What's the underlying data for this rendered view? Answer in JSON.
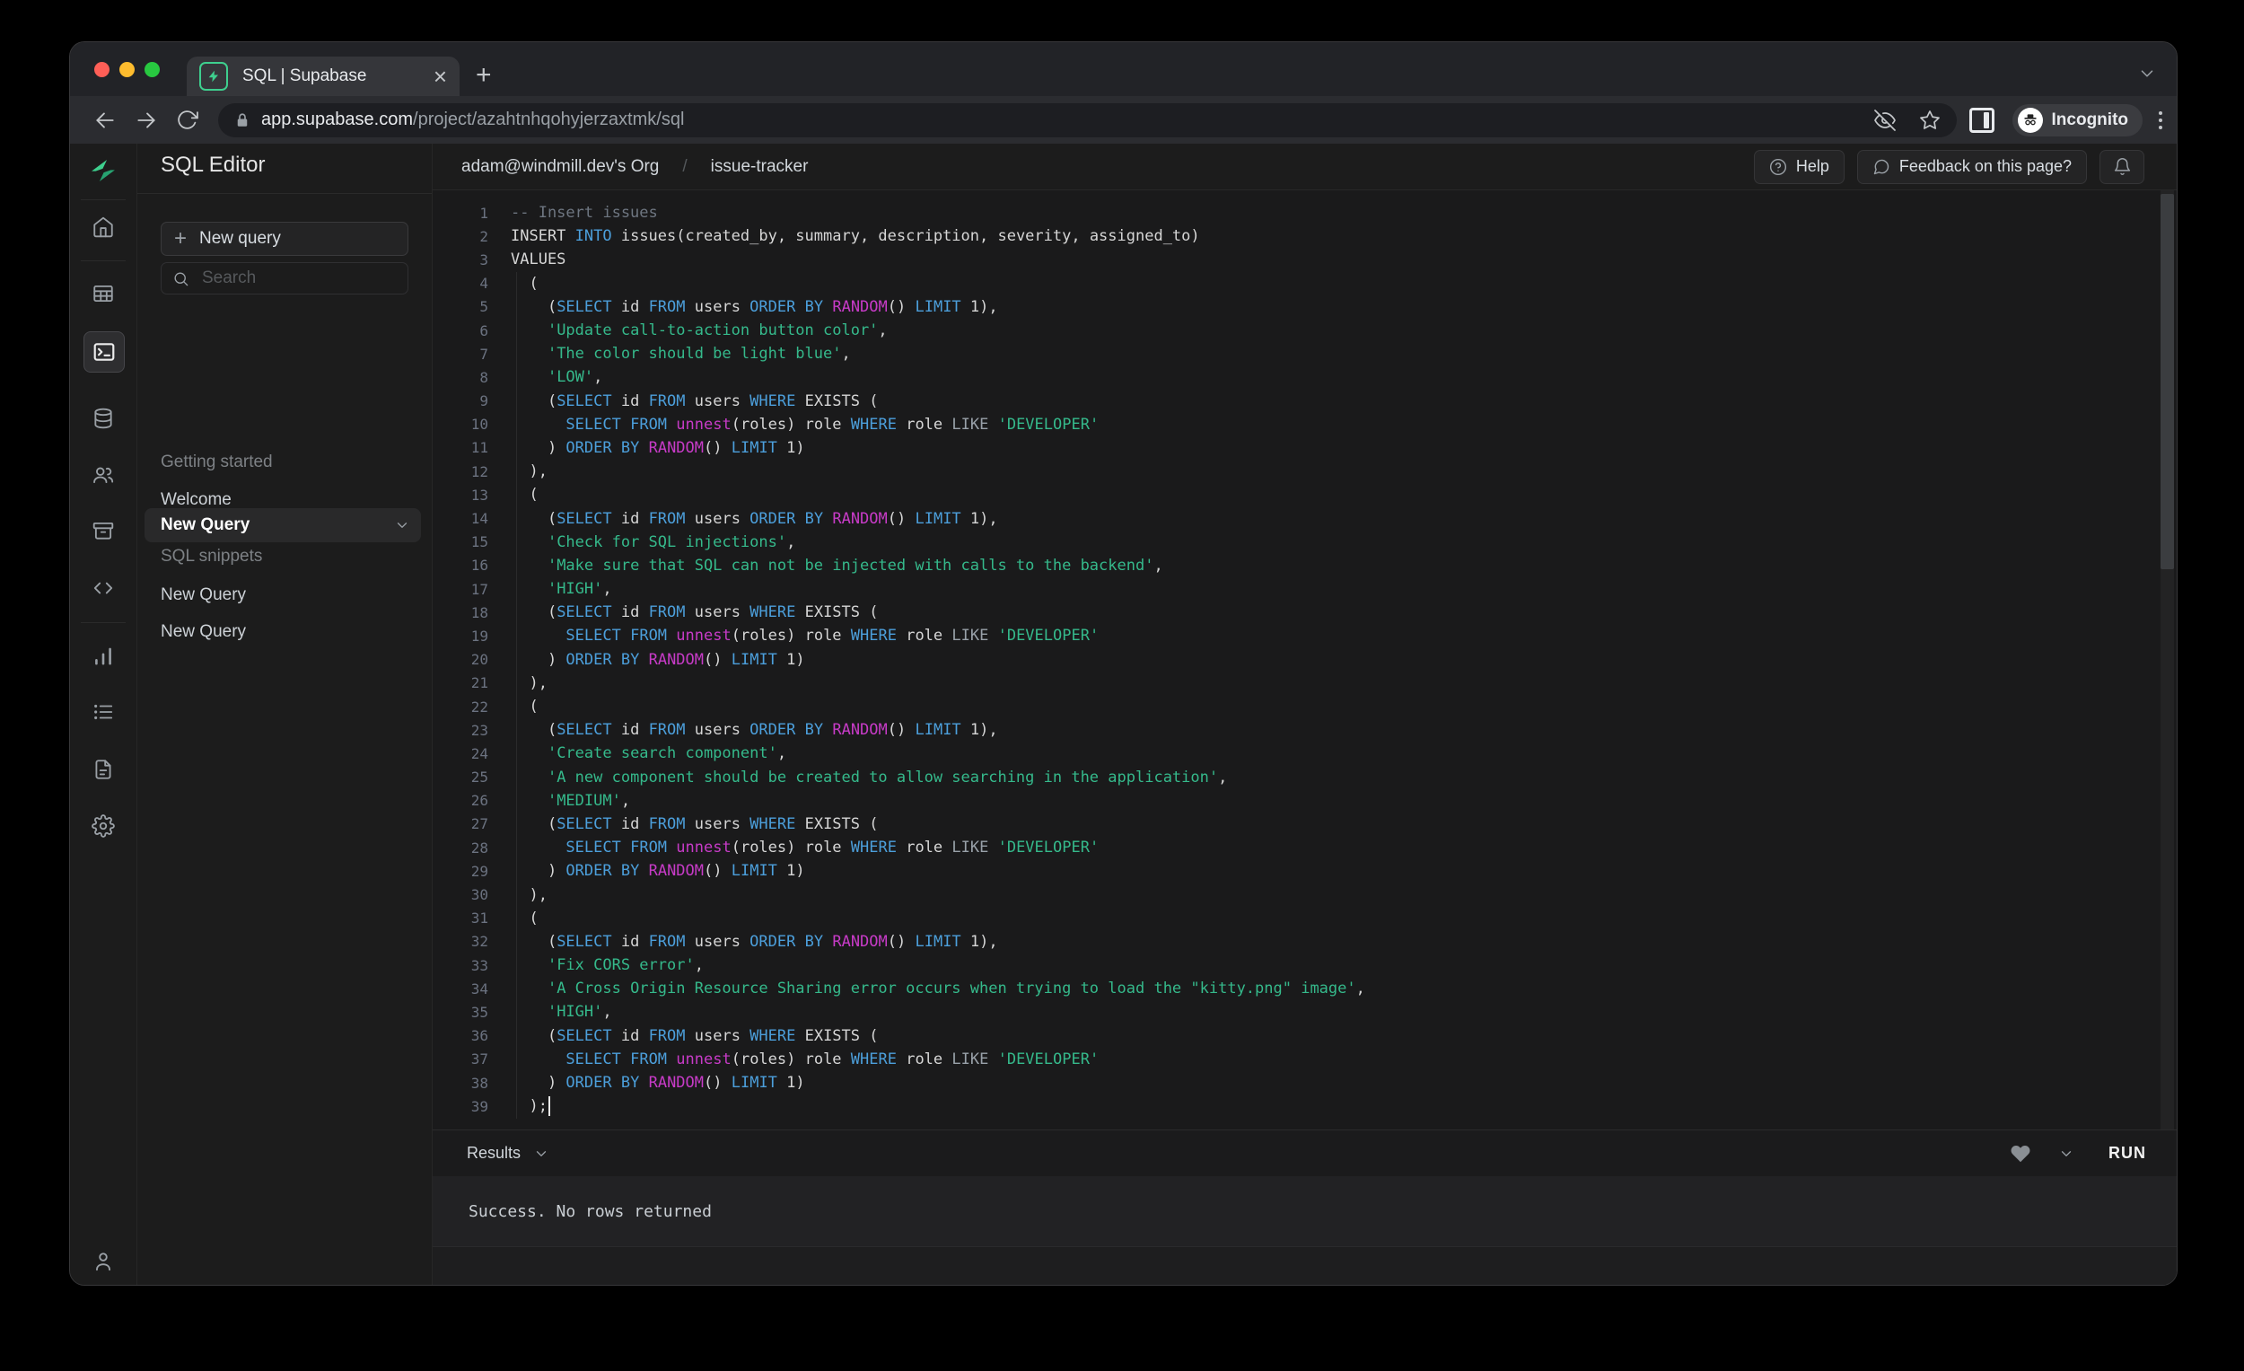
{
  "browser": {
    "tab_title": "SQL | Supabase",
    "url_host": "app.supabase.com",
    "url_path": "/project/azahtnhqohyjerzaxtmk/sql",
    "incognito_label": "Incognito"
  },
  "header": {
    "breadcrumb_org": "adam@windmill.dev's Org",
    "breadcrumb_sep": "/",
    "breadcrumb_project": "issue-tracker",
    "help_label": "Help",
    "feedback_label": "Feedback on this page?"
  },
  "sidebar_rail": {
    "active": "sql-editor",
    "items": [
      "home",
      "table-editor",
      "sql-editor",
      "database",
      "auth",
      "storage",
      "api",
      "reports",
      "logs",
      "docs",
      "settings",
      "account"
    ]
  },
  "sidebar": {
    "title": "SQL Editor",
    "new_query_button": "New query",
    "search_placeholder": "Search",
    "sections": [
      {
        "label": "Getting started",
        "items": [
          {
            "label": "Welcome"
          }
        ]
      },
      {
        "label": "SQL snippets",
        "items": [
          {
            "label": "New Query"
          },
          {
            "label": "New Query"
          },
          {
            "label": "New Query",
            "selected": true
          }
        ]
      }
    ]
  },
  "results": {
    "label": "Results",
    "run_label": "RUN",
    "message": "Success. No rows returned"
  },
  "colors": {
    "brand_green": "#3ecf8e",
    "keyword_blue": "#4c9fdb",
    "function_magenta": "#c73bc7",
    "string_green": "#35b98b"
  },
  "editor": {
    "cursor_line": 39,
    "lines": [
      [
        [
          "cmt",
          "-- Insert issues"
        ]
      ],
      [
        [
          "pl",
          "INSERT "
        ],
        [
          "kw",
          "INTO"
        ],
        [
          "pl",
          " issues(created_by, summary, description, severity, assigned_to)"
        ]
      ],
      [
        [
          "pl",
          "VALUES"
        ]
      ],
      [
        [
          "pl",
          "  ("
        ]
      ],
      [
        [
          "pl",
          "    ("
        ],
        [
          "kw",
          "SELECT"
        ],
        [
          "pl",
          " id "
        ],
        [
          "kw",
          "FROM"
        ],
        [
          "pl",
          " users "
        ],
        [
          "kw",
          "ORDER"
        ],
        [
          "pl",
          " "
        ],
        [
          "kw",
          "BY"
        ],
        [
          "pl",
          " "
        ],
        [
          "fn",
          "RANDOM"
        ],
        [
          "pl",
          "() "
        ],
        [
          "kw",
          "LIMIT"
        ],
        [
          "pl",
          " 1),"
        ]
      ],
      [
        [
          "pl",
          "    "
        ],
        [
          "str",
          "'Update call-to-action button color'"
        ],
        [
          "pl",
          ","
        ]
      ],
      [
        [
          "pl",
          "    "
        ],
        [
          "str",
          "'The color should be light blue'"
        ],
        [
          "pl",
          ","
        ]
      ],
      [
        [
          "pl",
          "    "
        ],
        [
          "str",
          "'LOW'"
        ],
        [
          "pl",
          ","
        ]
      ],
      [
        [
          "pl",
          "    ("
        ],
        [
          "kw",
          "SELECT"
        ],
        [
          "pl",
          " id "
        ],
        [
          "kw",
          "FROM"
        ],
        [
          "pl",
          " users "
        ],
        [
          "kw",
          "WHERE"
        ],
        [
          "pl",
          " EXISTS ("
        ]
      ],
      [
        [
          "pl",
          "      "
        ],
        [
          "kw",
          "SELECT"
        ],
        [
          "pl",
          " "
        ],
        [
          "kw",
          "FROM"
        ],
        [
          "pl",
          " "
        ],
        [
          "fn",
          "unnest"
        ],
        [
          "pl",
          "(roles) role "
        ],
        [
          "kw",
          "WHERE"
        ],
        [
          "pl",
          " role "
        ],
        [
          "op",
          "LIKE"
        ],
        [
          "pl",
          " "
        ],
        [
          "str",
          "'DEVELOPER'"
        ]
      ],
      [
        [
          "pl",
          "    ) "
        ],
        [
          "kw",
          "ORDER"
        ],
        [
          "pl",
          " "
        ],
        [
          "kw",
          "BY"
        ],
        [
          "pl",
          " "
        ],
        [
          "fn",
          "RANDOM"
        ],
        [
          "pl",
          "() "
        ],
        [
          "kw",
          "LIMIT"
        ],
        [
          "pl",
          " 1)"
        ]
      ],
      [
        [
          "pl",
          "  ),"
        ]
      ],
      [
        [
          "pl",
          "  ("
        ]
      ],
      [
        [
          "pl",
          "    ("
        ],
        [
          "kw",
          "SELECT"
        ],
        [
          "pl",
          " id "
        ],
        [
          "kw",
          "FROM"
        ],
        [
          "pl",
          " users "
        ],
        [
          "kw",
          "ORDER"
        ],
        [
          "pl",
          " "
        ],
        [
          "kw",
          "BY"
        ],
        [
          "pl",
          " "
        ],
        [
          "fn",
          "RANDOM"
        ],
        [
          "pl",
          "() "
        ],
        [
          "kw",
          "LIMIT"
        ],
        [
          "pl",
          " 1),"
        ]
      ],
      [
        [
          "pl",
          "    "
        ],
        [
          "str",
          "'Check for SQL injections'"
        ],
        [
          "pl",
          ","
        ]
      ],
      [
        [
          "pl",
          "    "
        ],
        [
          "str",
          "'Make sure that SQL can not be injected with calls to the backend'"
        ],
        [
          "pl",
          ","
        ]
      ],
      [
        [
          "pl",
          "    "
        ],
        [
          "str",
          "'HIGH'"
        ],
        [
          "pl",
          ","
        ]
      ],
      [
        [
          "pl",
          "    ("
        ],
        [
          "kw",
          "SELECT"
        ],
        [
          "pl",
          " id "
        ],
        [
          "kw",
          "FROM"
        ],
        [
          "pl",
          " users "
        ],
        [
          "kw",
          "WHERE"
        ],
        [
          "pl",
          " EXISTS ("
        ]
      ],
      [
        [
          "pl",
          "      "
        ],
        [
          "kw",
          "SELECT"
        ],
        [
          "pl",
          " "
        ],
        [
          "kw",
          "FROM"
        ],
        [
          "pl",
          " "
        ],
        [
          "fn",
          "unnest"
        ],
        [
          "pl",
          "(roles) role "
        ],
        [
          "kw",
          "WHERE"
        ],
        [
          "pl",
          " role "
        ],
        [
          "op",
          "LIKE"
        ],
        [
          "pl",
          " "
        ],
        [
          "str",
          "'DEVELOPER'"
        ]
      ],
      [
        [
          "pl",
          "    ) "
        ],
        [
          "kw",
          "ORDER"
        ],
        [
          "pl",
          " "
        ],
        [
          "kw",
          "BY"
        ],
        [
          "pl",
          " "
        ],
        [
          "fn",
          "RANDOM"
        ],
        [
          "pl",
          "() "
        ],
        [
          "kw",
          "LIMIT"
        ],
        [
          "pl",
          " 1)"
        ]
      ],
      [
        [
          "pl",
          "  ),"
        ]
      ],
      [
        [
          "pl",
          "  ("
        ]
      ],
      [
        [
          "pl",
          "    ("
        ],
        [
          "kw",
          "SELECT"
        ],
        [
          "pl",
          " id "
        ],
        [
          "kw",
          "FROM"
        ],
        [
          "pl",
          " users "
        ],
        [
          "kw",
          "ORDER"
        ],
        [
          "pl",
          " "
        ],
        [
          "kw",
          "BY"
        ],
        [
          "pl",
          " "
        ],
        [
          "fn",
          "RANDOM"
        ],
        [
          "pl",
          "() "
        ],
        [
          "kw",
          "LIMIT"
        ],
        [
          "pl",
          " 1),"
        ]
      ],
      [
        [
          "pl",
          "    "
        ],
        [
          "str",
          "'Create search component'"
        ],
        [
          "pl",
          ","
        ]
      ],
      [
        [
          "pl",
          "    "
        ],
        [
          "str",
          "'A new component should be created to allow searching in the application'"
        ],
        [
          "pl",
          ","
        ]
      ],
      [
        [
          "pl",
          "    "
        ],
        [
          "str",
          "'MEDIUM'"
        ],
        [
          "pl",
          ","
        ]
      ],
      [
        [
          "pl",
          "    ("
        ],
        [
          "kw",
          "SELECT"
        ],
        [
          "pl",
          " id "
        ],
        [
          "kw",
          "FROM"
        ],
        [
          "pl",
          " users "
        ],
        [
          "kw",
          "WHERE"
        ],
        [
          "pl",
          " EXISTS ("
        ]
      ],
      [
        [
          "pl",
          "      "
        ],
        [
          "kw",
          "SELECT"
        ],
        [
          "pl",
          " "
        ],
        [
          "kw",
          "FROM"
        ],
        [
          "pl",
          " "
        ],
        [
          "fn",
          "unnest"
        ],
        [
          "pl",
          "(roles) role "
        ],
        [
          "kw",
          "WHERE"
        ],
        [
          "pl",
          " role "
        ],
        [
          "op",
          "LIKE"
        ],
        [
          "pl",
          " "
        ],
        [
          "str",
          "'DEVELOPER'"
        ]
      ],
      [
        [
          "pl",
          "    ) "
        ],
        [
          "kw",
          "ORDER"
        ],
        [
          "pl",
          " "
        ],
        [
          "kw",
          "BY"
        ],
        [
          "pl",
          " "
        ],
        [
          "fn",
          "RANDOM"
        ],
        [
          "pl",
          "() "
        ],
        [
          "kw",
          "LIMIT"
        ],
        [
          "pl",
          " 1)"
        ]
      ],
      [
        [
          "pl",
          "  ),"
        ]
      ],
      [
        [
          "pl",
          "  ("
        ]
      ],
      [
        [
          "pl",
          "    ("
        ],
        [
          "kw",
          "SELECT"
        ],
        [
          "pl",
          " id "
        ],
        [
          "kw",
          "FROM"
        ],
        [
          "pl",
          " users "
        ],
        [
          "kw",
          "ORDER"
        ],
        [
          "pl",
          " "
        ],
        [
          "kw",
          "BY"
        ],
        [
          "pl",
          " "
        ],
        [
          "fn",
          "RANDOM"
        ],
        [
          "pl",
          "() "
        ],
        [
          "kw",
          "LIMIT"
        ],
        [
          "pl",
          " 1),"
        ]
      ],
      [
        [
          "pl",
          "    "
        ],
        [
          "str",
          "'Fix CORS error'"
        ],
        [
          "pl",
          ","
        ]
      ],
      [
        [
          "pl",
          "    "
        ],
        [
          "str",
          "'A Cross Origin Resource Sharing error occurs when trying to load the \"kitty.png\" image'"
        ],
        [
          "pl",
          ","
        ]
      ],
      [
        [
          "pl",
          "    "
        ],
        [
          "str",
          "'HIGH'"
        ],
        [
          "pl",
          ","
        ]
      ],
      [
        [
          "pl",
          "    ("
        ],
        [
          "kw",
          "SELECT"
        ],
        [
          "pl",
          " id "
        ],
        [
          "kw",
          "FROM"
        ],
        [
          "pl",
          " users "
        ],
        [
          "kw",
          "WHERE"
        ],
        [
          "pl",
          " EXISTS ("
        ]
      ],
      [
        [
          "pl",
          "      "
        ],
        [
          "kw",
          "SELECT"
        ],
        [
          "pl",
          " "
        ],
        [
          "kw",
          "FROM"
        ],
        [
          "pl",
          " "
        ],
        [
          "fn",
          "unnest"
        ],
        [
          "pl",
          "(roles) role "
        ],
        [
          "kw",
          "WHERE"
        ],
        [
          "pl",
          " role "
        ],
        [
          "op",
          "LIKE"
        ],
        [
          "pl",
          " "
        ],
        [
          "str",
          "'DEVELOPER'"
        ]
      ],
      [
        [
          "pl",
          "    ) "
        ],
        [
          "kw",
          "ORDER"
        ],
        [
          "pl",
          " "
        ],
        [
          "kw",
          "BY"
        ],
        [
          "pl",
          " "
        ],
        [
          "fn",
          "RANDOM"
        ],
        [
          "pl",
          "() "
        ],
        [
          "kw",
          "LIMIT"
        ],
        [
          "pl",
          " 1)"
        ]
      ],
      [
        [
          "pl",
          "  );"
        ]
      ]
    ]
  }
}
